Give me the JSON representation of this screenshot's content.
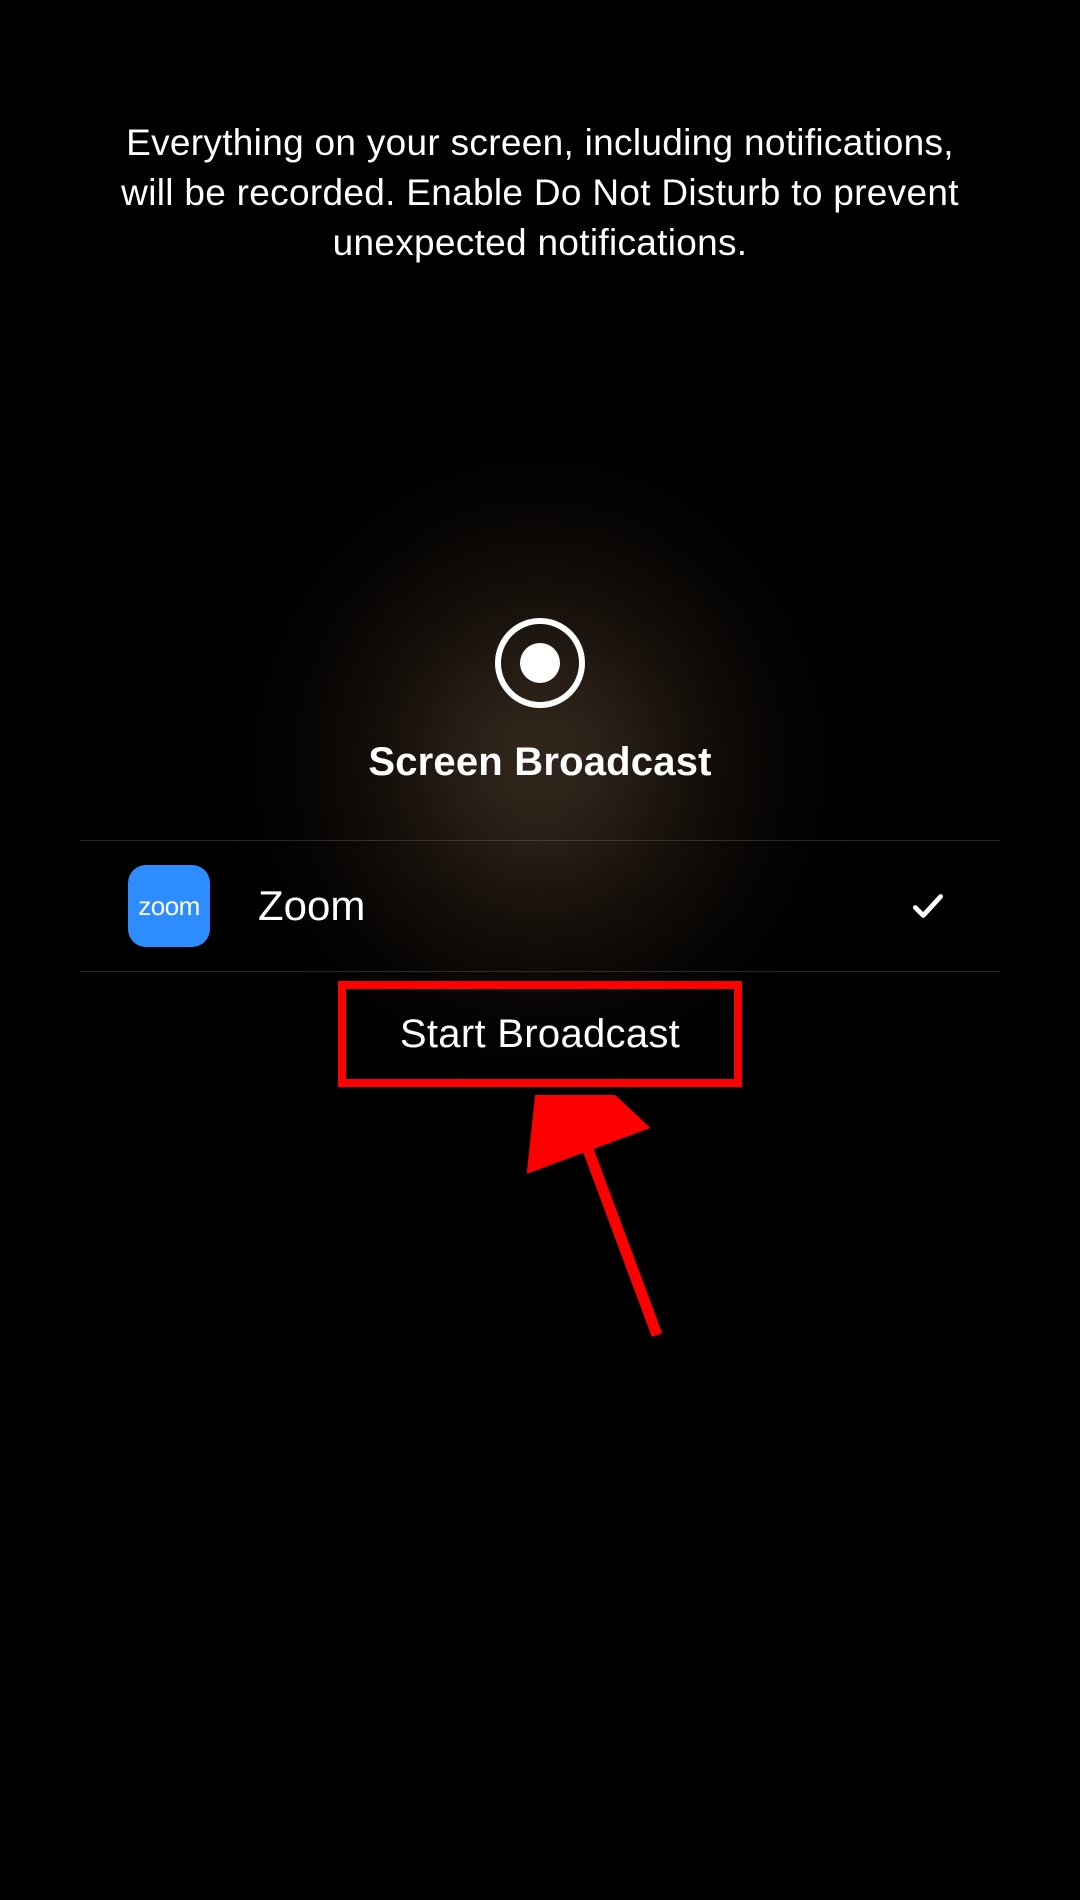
{
  "warning": {
    "text": "Everything on your screen, including notifications, will be recorded. Enable Do Not Disturb to prevent unexpected notifications."
  },
  "broadcast": {
    "title": "Screen Broadcast",
    "app": {
      "icon_label": "zoom",
      "name": "Zoom"
    },
    "start_button": "Start Broadcast"
  }
}
